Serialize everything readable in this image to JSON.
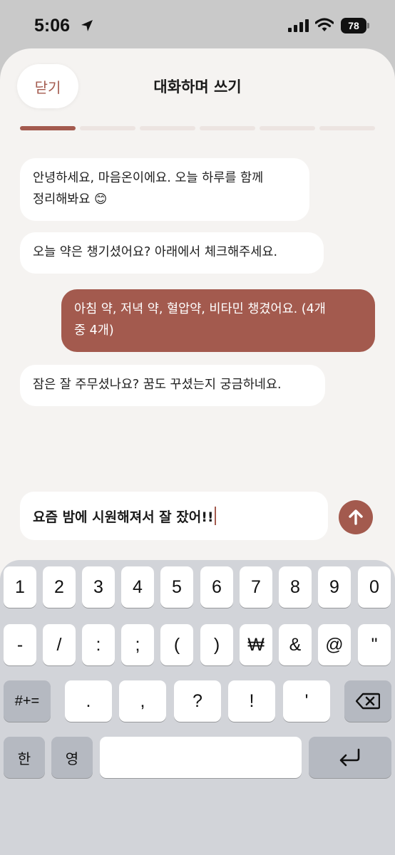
{
  "status": {
    "time": "5:06",
    "battery": "78"
  },
  "header": {
    "close_label": "닫기",
    "title": "대화하며 쓰기"
  },
  "progress": {
    "segments": 6,
    "current": 1
  },
  "messages": [
    {
      "role": "bot",
      "text": "안녕하세요, 마음온이에요. 오늘 하루를 함께\n정리해봐요 😊"
    },
    {
      "role": "bot",
      "text": "오늘 약은 챙기셨어요? 아래에서 체크해주세요."
    },
    {
      "role": "user",
      "text": "아침 약, 저녁 약, 혈압약, 비타민 챙겼어요. (4개\n중 4개)"
    },
    {
      "role": "bot",
      "text": "잠은 잘 주무셨나요? 꿈도 꾸셨는지 궁금하네요."
    }
  ],
  "composer": {
    "value": "요즘 밤에 시원해져서 잘 잤어!!"
  },
  "keyboard": {
    "row1": [
      "1",
      "2",
      "3",
      "4",
      "5",
      "6",
      "7",
      "8",
      "9",
      "0"
    ],
    "row2": [
      "-",
      "/",
      ":",
      ";",
      "(",
      ")",
      "₩",
      "&",
      "@",
      "\""
    ],
    "row3": [
      ".",
      ",",
      "?",
      "!",
      "'"
    ],
    "symbols_key": "#+=",
    "lang_key_1": "한",
    "lang_key_2": "영"
  },
  "colors": {
    "accent": "#a35a4e",
    "background": "#f5f3f1",
    "keyboard": "#d2d4d9"
  }
}
